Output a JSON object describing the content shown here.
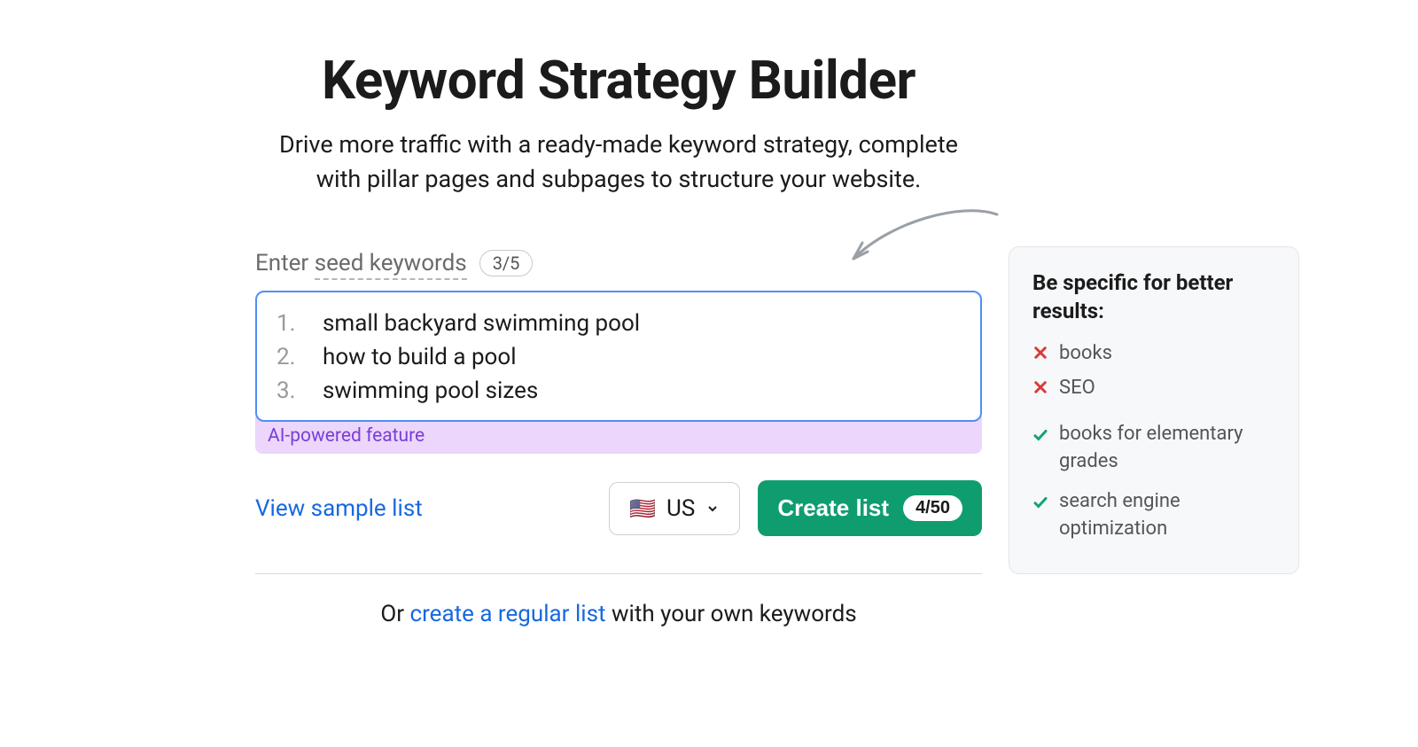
{
  "header": {
    "title": "Keyword Strategy Builder",
    "subtitle": "Drive more traffic with a ready-made keyword strategy, complete with pillar pages and subpages to structure your website."
  },
  "seed": {
    "label_prefix": "Enter ",
    "label_underlined": "seed keywords",
    "count": "3/5",
    "keywords": [
      "small backyard swimming pool",
      "how to build a pool",
      "swimming pool sizes"
    ],
    "ai_label": "AI-powered feature"
  },
  "actions": {
    "view_sample": "View sample list",
    "country_code": "US",
    "country_flag": "🇺🇸",
    "create_label": "Create list",
    "quota": "4/50"
  },
  "alt": {
    "prefix": "Or ",
    "link": "create a regular list",
    "suffix": " with your own keywords"
  },
  "tip": {
    "title": "Be specific for better results:",
    "bad": [
      "books",
      "SEO"
    ],
    "good": [
      "books for elementary grades",
      "search engine optimization"
    ]
  }
}
